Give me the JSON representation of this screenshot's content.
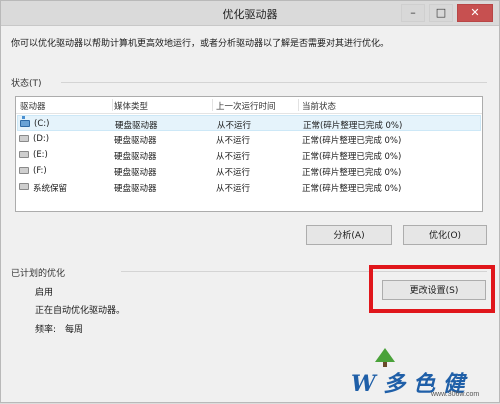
{
  "window": {
    "title": "优化驱动器",
    "minimize_glyph": "–",
    "maximize_glyph": "□",
    "close_glyph": "✕"
  },
  "description": "你可以优化驱动器以帮助计算机更高效地运行，或者分析驱动器以了解是否需要对其进行优化。",
  "status": {
    "label": "状态(T)",
    "columns": [
      "驱动器",
      "媒体类型",
      "上一次运行时间",
      "当前状态"
    ],
    "rows": [
      {
        "drive": "(C:)",
        "icon": "system-drive-icon",
        "media": "硬盘驱动器",
        "last_run": "从不运行",
        "state": "正常(碎片整理已完成 0%)",
        "selected": true
      },
      {
        "drive": "(D:)",
        "icon": "drive-icon",
        "media": "硬盘驱动器",
        "last_run": "从不运行",
        "state": "正常(碎片整理已完成 0%)",
        "selected": false
      },
      {
        "drive": "(E:)",
        "icon": "drive-icon",
        "media": "硬盘驱动器",
        "last_run": "从不运行",
        "state": "正常(碎片整理已完成 0%)",
        "selected": false
      },
      {
        "drive": "(F:)",
        "icon": "drive-icon",
        "media": "硬盘驱动器",
        "last_run": "从不运行",
        "state": "正常(碎片整理已完成 0%)",
        "selected": false
      },
      {
        "drive": "系统保留",
        "icon": "drive-icon",
        "media": "硬盘驱动器",
        "last_run": "从不运行",
        "state": "正常(碎片整理已完成 0%)",
        "selected": false
      }
    ]
  },
  "buttons": {
    "analyze": "分析(A)",
    "optimize": "优化(O)",
    "change_settings": "更改设置(S)"
  },
  "schedule": {
    "label": "已计划的优化",
    "enabled": "启用",
    "running_text": "正在自动优化驱动器。",
    "frequency_label": "频率:",
    "frequency_value": "每周"
  },
  "watermark": {
    "text": "W 多 色 健",
    "url": "www.306w.com"
  },
  "colors": {
    "highlight": "#e0161b",
    "selection": "#e5f3fb",
    "watermark": "#1f5fa8"
  }
}
